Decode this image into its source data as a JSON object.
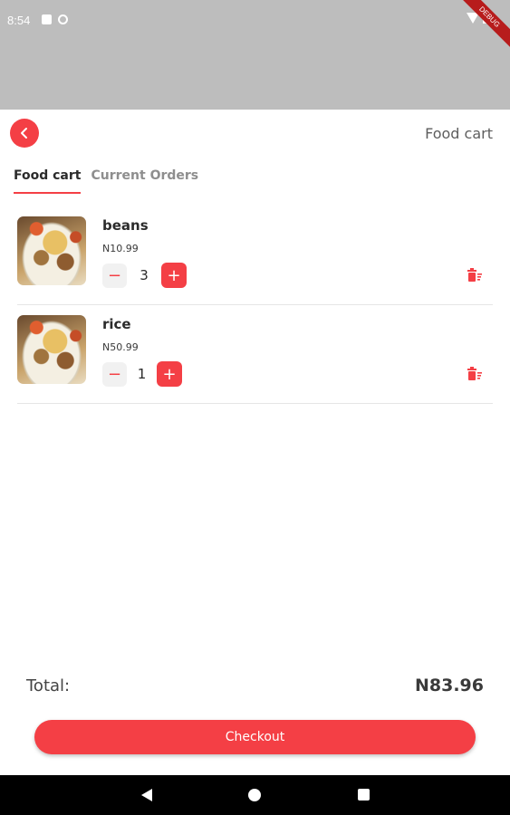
{
  "status_bar": {
    "time": "8:54",
    "debug_banner": "DEBUG"
  },
  "header": {
    "back_icon": "chevron-left-icon",
    "title": "Food cart"
  },
  "tabs": [
    {
      "label": "Food cart",
      "active": true
    },
    {
      "label": "Current Orders",
      "active": false
    }
  ],
  "cart": {
    "items": [
      {
        "name": "beans",
        "price": "N10.99",
        "quantity": "3"
      },
      {
        "name": "rice",
        "price": "N50.99",
        "quantity": "1"
      }
    ]
  },
  "summary": {
    "total_label": "Total:",
    "total_value": "N83.96"
  },
  "checkout": {
    "label": "Checkout"
  },
  "colors": {
    "accent": "#f43f45",
    "status_bar": "#bdbdbd",
    "nav_bar": "#000000"
  }
}
